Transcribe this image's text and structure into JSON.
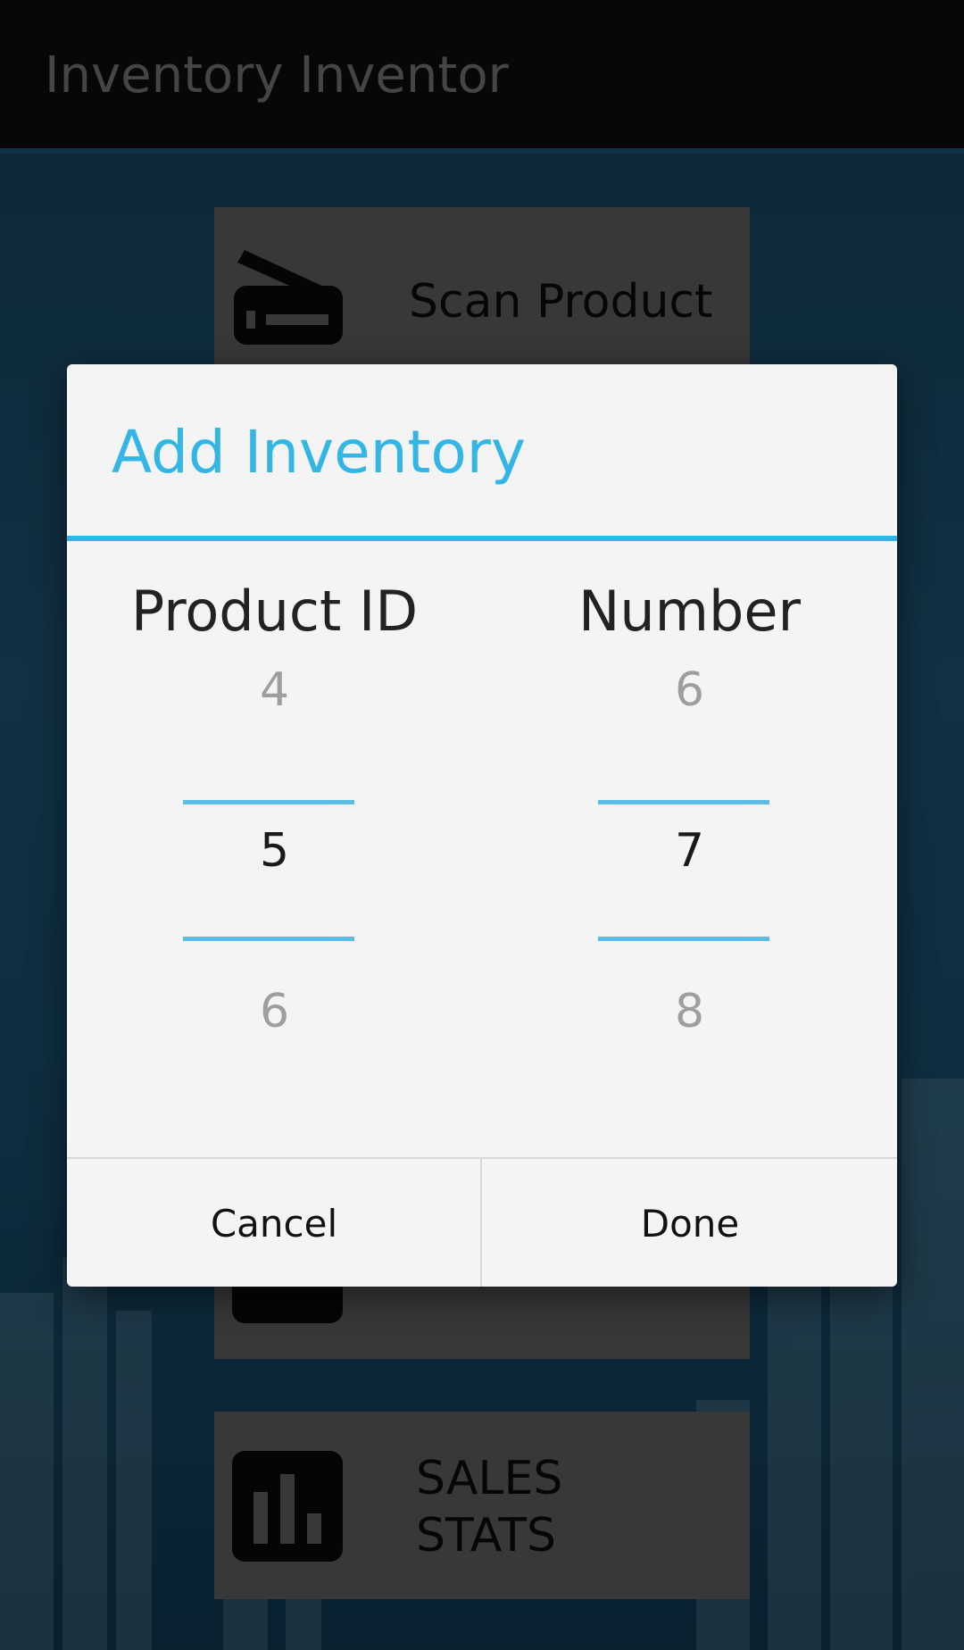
{
  "app": {
    "title": "Inventory Inventor"
  },
  "home": {
    "scan_label": "Scan Product",
    "sales_label_line1": "SALES",
    "sales_label_line2": "STATS"
  },
  "dialog": {
    "title": "Add Inventory",
    "columns": [
      {
        "header": "Product ID",
        "prev": "4",
        "selected": "5",
        "next": "6"
      },
      {
        "header": "Number",
        "prev": "6",
        "selected": "7",
        "next": "8"
      }
    ],
    "cancel_label": "Cancel",
    "done_label": "Done"
  },
  "colors": {
    "accent": "#33b5e5",
    "tile": "#676767"
  }
}
